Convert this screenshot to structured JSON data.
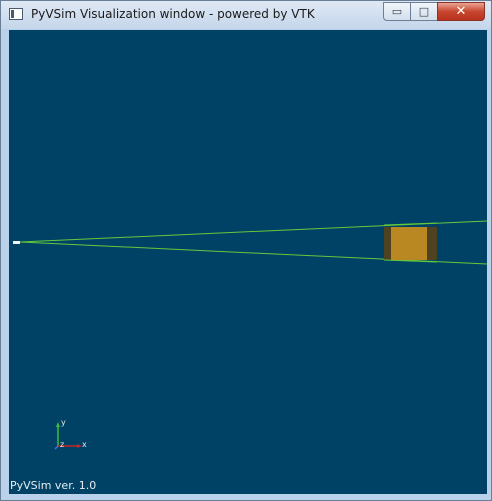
{
  "window": {
    "title": "PyVSim Visualization window - powered by VTK",
    "controls": {
      "minimize": "▭",
      "maximize": "□",
      "close": "✕"
    }
  },
  "viewport": {
    "background_color": "#004266",
    "ray_color": "#63c93a",
    "object_color": "#b98823",
    "footer": "PyVSim ver. 1.0",
    "axes": {
      "x_label": "x",
      "y_label": "y",
      "z_label": "z"
    }
  }
}
